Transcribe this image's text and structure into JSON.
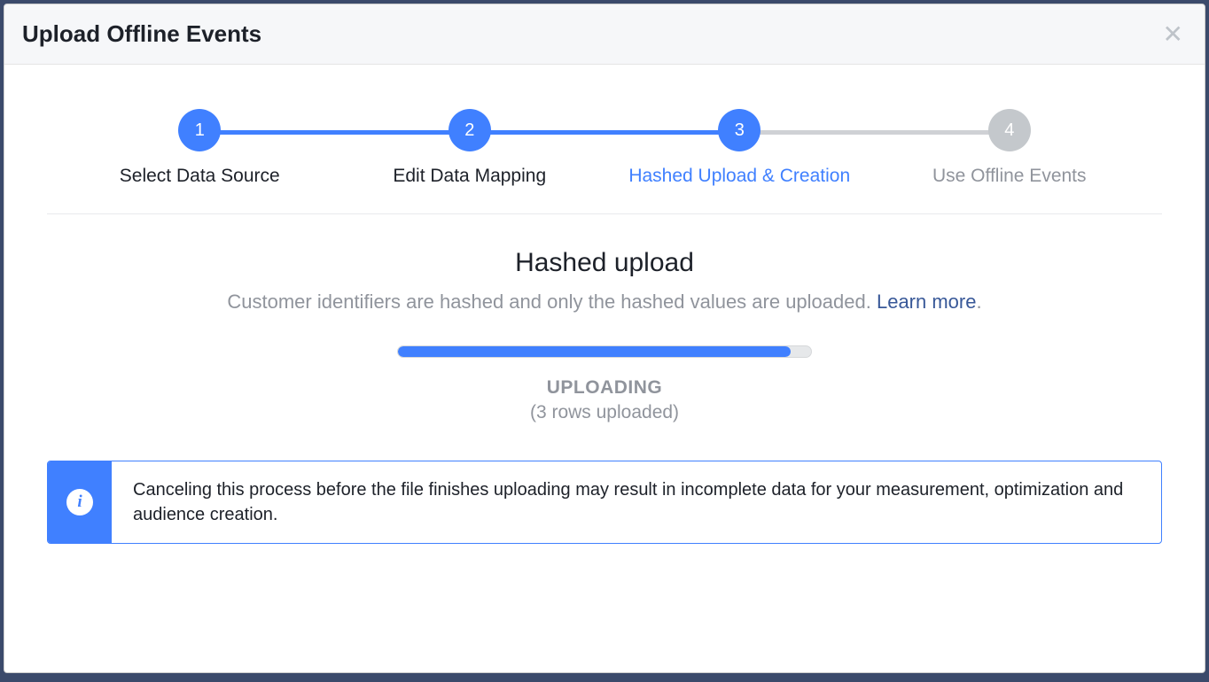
{
  "dialog": {
    "title": "Upload Offline Events"
  },
  "stepper": {
    "steps": [
      {
        "num": "1",
        "label": "Select Data Source"
      },
      {
        "num": "2",
        "label": "Edit Data Mapping"
      },
      {
        "num": "3",
        "label": "Hashed Upload & Creation"
      },
      {
        "num": "4",
        "label": "Use Offline Events"
      }
    ]
  },
  "content": {
    "title": "Hashed upload",
    "subtitle_prefix": "Customer identifiers are hashed and only the hashed values are uploaded. ",
    "learn_more": "Learn more",
    "subtitle_suffix": "."
  },
  "progress": {
    "percent": 95,
    "status": "UPLOADING",
    "rows": "(3 rows uploaded)"
  },
  "banner": {
    "icon_letter": "i",
    "text": "Canceling this process before the file finishes uploading may result in incomplete data for your measurement, optimization and audience creation."
  }
}
